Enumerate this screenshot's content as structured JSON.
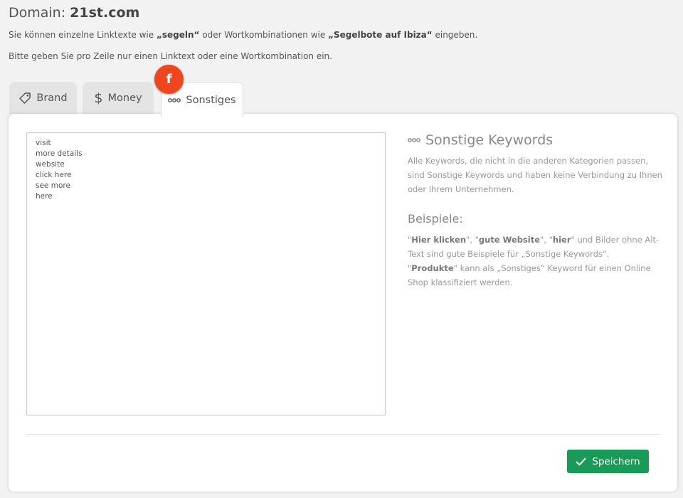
{
  "header": {
    "domain_label": "Domain: ",
    "domain_value": "21st.com",
    "intro1": {
      "prefix": "Sie können einzelne Linktexte wie ",
      "example1": "„segeln“",
      "middle": " oder Wortkombinationen wie ",
      "example2": "„Segelbote auf Ibiza“",
      "suffix": " eingeben."
    },
    "intro2": "Bitte geben Sie pro Zeile nur einen Linktext oder eine Wortkombination ein."
  },
  "tabs": [
    {
      "label": "Brand",
      "icon": "tag-icon"
    },
    {
      "label": "Money",
      "icon": "dollar-icon"
    },
    {
      "label": "Sonstiges",
      "icon": "dots-icon",
      "active": true
    }
  ],
  "badge": {
    "label": "f",
    "color": "#f0461f"
  },
  "editor": {
    "value": "visit\nmore details\nwebsite\nclick here\nsee more\nhere"
  },
  "info": {
    "title": "Sonstige Keywords",
    "description": "Alle Keywords, die nicht in die anderen Kategorien passen, sind Sonstige Keywords und haben keine Verbindung zu Ihnen oder Ihrem Unternehmen.",
    "examples_title": "Beispiele:",
    "ex1": {
      "q1": "\"",
      "b1": "Hier klicken",
      "q2": "\", \"",
      "b2": "gute Website",
      "q3": "\", \"",
      "b3": "hier",
      "rest": "\" und Bilder ohne Alt-Text sind gute Beispiele für „Sonstige Keywords“."
    },
    "ex2": {
      "q1": "\"",
      "b1": "Produkte",
      "rest": "\" kann als „Sonstiges“ Keyword für einen Online Shop klassifiziert werden."
    }
  },
  "save_button": {
    "label": "Speichern",
    "icon": "check-icon",
    "color": "#199a57"
  },
  "colors": {
    "background": "#f2f2f2",
    "panel": "#ffffff",
    "tab_inactive": "#e4e4e4"
  }
}
